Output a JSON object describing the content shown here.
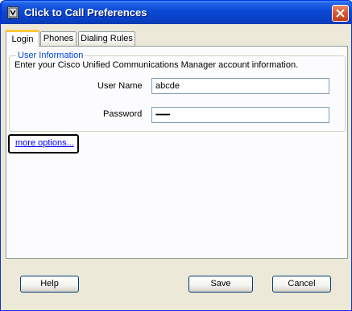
{
  "window": {
    "title": "Click to Call Preferences",
    "icon": "app-phone-icon",
    "close_icon": "close-icon"
  },
  "tabs": [
    {
      "label": "Login",
      "active": true
    },
    {
      "label": "Phones",
      "active": false
    },
    {
      "label": "Dialing Rules",
      "active": false
    }
  ],
  "user_info": {
    "legend": "User Information",
    "description": "Enter your Cisco Unified Communications Manager account information.",
    "username_label": "User Name",
    "username_value": "abcde",
    "password_label": "Password",
    "password_value": "••••••••••••"
  },
  "more_options": "more options...",
  "buttons": {
    "help": "Help",
    "save": "Save",
    "cancel": "Cancel"
  },
  "colors": {
    "title_bar": "#0a49d4",
    "dialog_bg": "#ece9d8",
    "legend_text": "#0046d5",
    "link": "#0000ff",
    "close_button": "#d85a34"
  }
}
